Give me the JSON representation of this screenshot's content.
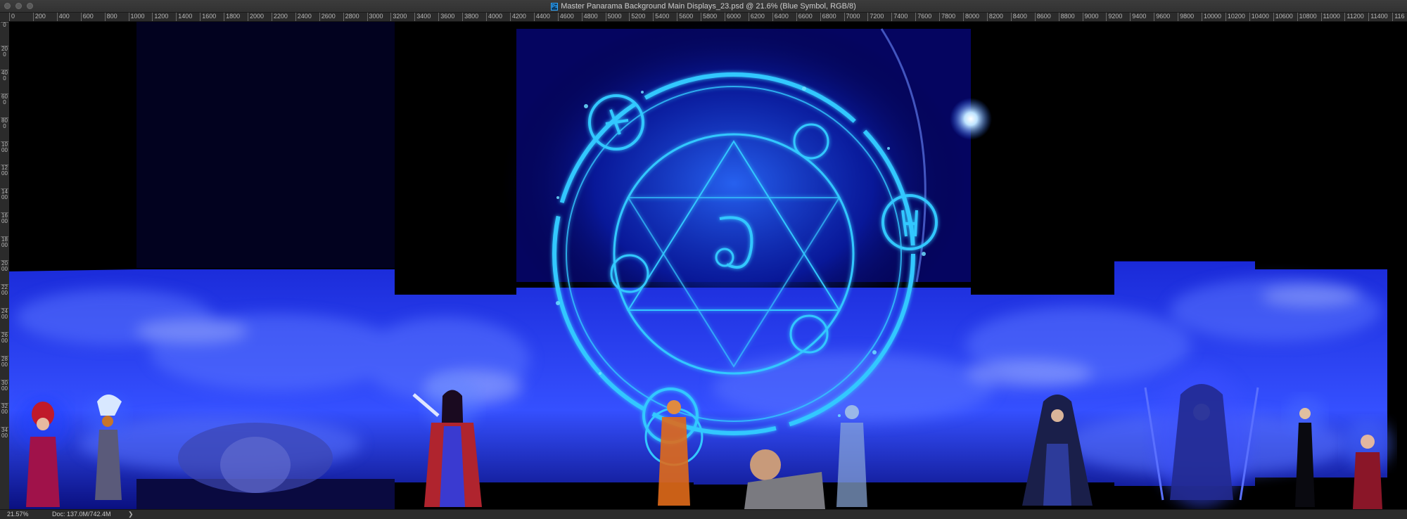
{
  "window": {
    "title": "Master Panarama Background Main Displays_23.psd @ 21.6% (Blue Symbol, RGB/8)",
    "app_icon": "photoshop-icon"
  },
  "ruler_top": [
    "0",
    "200",
    "400",
    "600",
    "800",
    "1000",
    "1200",
    "1400",
    "1600",
    "1800",
    "2000",
    "2200",
    "2400",
    "2600",
    "2800",
    "3000",
    "3200",
    "3400",
    "3600",
    "3800",
    "4000",
    "4200",
    "4400",
    "4600",
    "4800",
    "5000",
    "5200",
    "5400",
    "5600",
    "5800",
    "6000",
    "6200",
    "6400",
    "6600",
    "6800",
    "7000",
    "7200",
    "7400",
    "7600",
    "7800",
    "8000",
    "8200",
    "8400",
    "8600",
    "8800",
    "9000",
    "9200",
    "9400",
    "9600",
    "9800",
    "10000",
    "10200",
    "10400",
    "10600",
    "10800",
    "11000",
    "11200",
    "11400",
    "116"
  ],
  "ruler_left": [
    "0",
    "200",
    "400",
    "600",
    "800",
    "1000",
    "1200",
    "1400",
    "1600",
    "1800",
    "2000",
    "2200",
    "2400",
    "2600",
    "2800",
    "3000",
    "3200",
    "3400"
  ],
  "canvas": {
    "layer": "Blue Symbol",
    "accent": "#33c8ff",
    "sky": "#0a0a6e",
    "cloud": "#3a4fff"
  },
  "status": {
    "zoom": "21.57%",
    "doc": "Doc: 137.0M/742.4M",
    "arrow": "❯"
  }
}
